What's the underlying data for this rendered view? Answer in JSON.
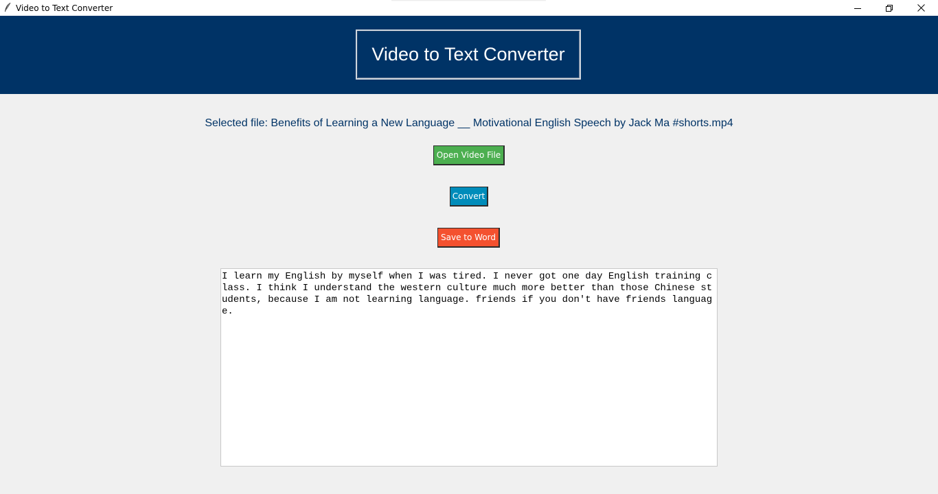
{
  "window": {
    "title": "Video to Text Converter",
    "icon": "feather-icon",
    "controls": [
      "minimize-icon",
      "maximize-icon",
      "close-icon"
    ]
  },
  "header": {
    "title": "Video to Text Converter",
    "background": "#003366"
  },
  "selected_file": {
    "text": "Selected file: Benefits of Learning a New Language __ Motivational English Speech by Jack Ma #shorts.mp4"
  },
  "buttons": {
    "open_label": "Open Video File",
    "open_color": "#4caf50",
    "convert_label": "Convert",
    "convert_color": "#008cba",
    "save_label": "Save to Word",
    "save_color": "#f4512f"
  },
  "transcript": {
    "text": "I learn my English by myself when I was tired. I never got one day English training class. I think I understand the western culture much more better than those Chinese students, because I am not learning language. friends if you don't have friends language."
  }
}
